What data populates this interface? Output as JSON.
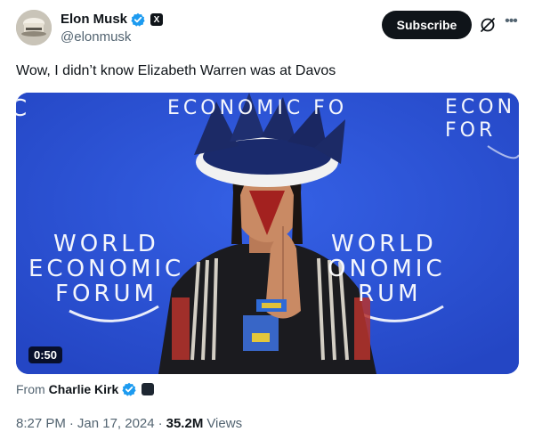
{
  "author": {
    "display_name": "Elon Musk",
    "handle": "@elonmusk",
    "verified": true,
    "affiliate_badge": "X"
  },
  "actions": {
    "subscribe_label": "Subscribe"
  },
  "tweet": {
    "text": "Wow, I didn’t know Elizabeth Warren was at Davos"
  },
  "video": {
    "duration": "0:50",
    "backdrop_text_top_center": "ECONOMIC FO",
    "backdrop_text_top_right": "ECON FOR",
    "backdrop_text_left_lines": [
      "WORLD",
      "ECONOMIC",
      "FORUM"
    ],
    "backdrop_text_right_lines": [
      "WORLD",
      "ONOMIC",
      "RUM"
    ],
    "backdrop_left_edge": "C"
  },
  "source": {
    "from_label": "From",
    "name": "Charlie Kirk",
    "verified": true
  },
  "meta": {
    "time": "8:27 PM",
    "sep1": "·",
    "date": "Jan 17, 2024",
    "sep2": "·",
    "views_count": "35.2M",
    "views_label": "Views"
  },
  "colors": {
    "verified_blue": "#1d9bf0",
    "text_primary": "#0f1419",
    "text_secondary": "#536471",
    "wef_blue": "#2d52d6"
  }
}
